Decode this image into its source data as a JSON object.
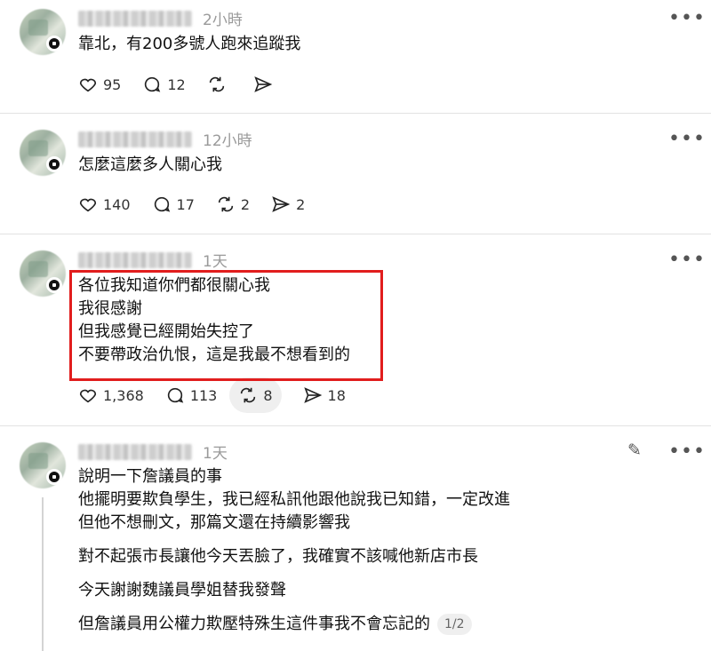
{
  "posts": [
    {
      "username": "chenuser12321",
      "time": "2小時",
      "lines": [
        "靠北，有200多號人跑來追蹤我"
      ],
      "likes": "95",
      "replies": "12",
      "reposts": "",
      "shares": ""
    },
    {
      "username": "chenuser12321",
      "time": "12小時",
      "lines": [
        "怎麼這麼多人關心我"
      ],
      "likes": "140",
      "replies": "17",
      "reposts": "2",
      "shares": "2"
    },
    {
      "username": "chenuser12321",
      "time": "1天",
      "lines": [
        "各位我知道你們都很關心我",
        "我很感謝",
        "但我感覺已經開始失控了",
        "不要帶政治仇恨，這是我最不想看到的"
      ],
      "likes": "1,368",
      "replies": "113",
      "reposts": "8",
      "shares": "18"
    },
    {
      "username": "chenuser12321",
      "time": "1天",
      "lines": [
        "說明一下詹議員的事",
        "他擺明要欺負學生，我已經私訊他跟他說我已知錯，一定改進",
        "但他不想刪文，那篇文還在持續影響我",
        "對不起張市長讓他今天丟臉了，我確實不該喊他新店市長",
        "今天謝謝魏議員學姐替我發聲",
        "但詹議員用公權力欺壓特殊生這件事我不會忘記的"
      ],
      "page_indicator": "1/2"
    }
  ],
  "icons": {
    "more": "more-horizontal-icon",
    "like": "heart-icon",
    "reply": "comment-icon",
    "repost": "repost-icon",
    "share": "send-icon",
    "edit": "pencil-icon"
  },
  "colors": {
    "highlight_box": "#e11d1d",
    "muted_text": "#9a9a9a"
  }
}
